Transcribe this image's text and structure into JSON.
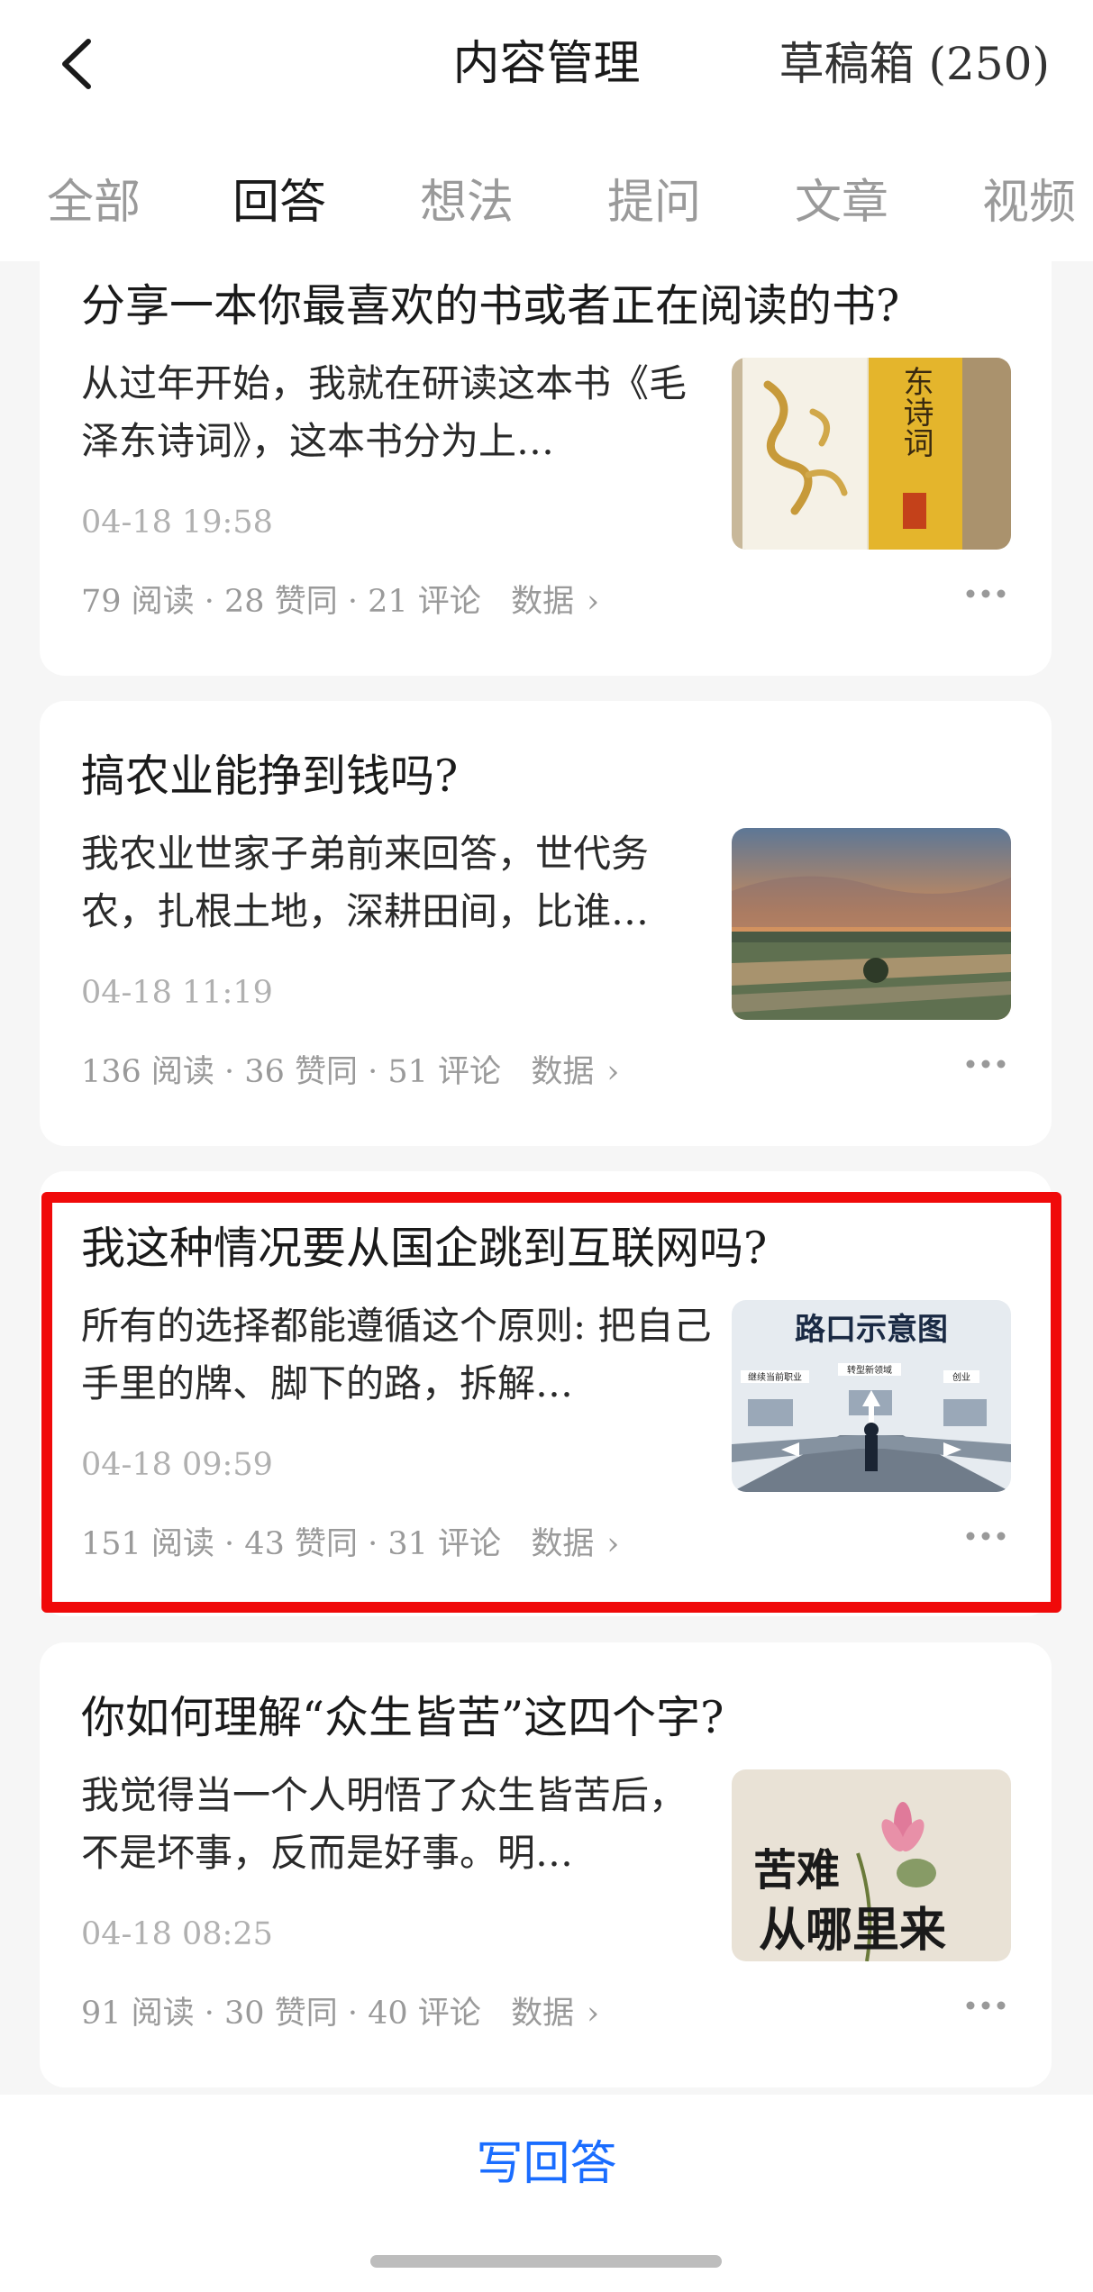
{
  "header": {
    "title": "内容管理",
    "drafts_label": "草稿箱 (250)"
  },
  "tabs": [
    {
      "label": "全部",
      "active": false
    },
    {
      "label": "回答",
      "active": true
    },
    {
      "label": "想法",
      "active": false
    },
    {
      "label": "提问",
      "active": false
    },
    {
      "label": "文章",
      "active": false
    },
    {
      "label": "视频",
      "active": false
    }
  ],
  "answers": [
    {
      "title": "分享一本你最喜欢的书或者正在阅读的书?",
      "excerpt": "从过年开始，我就在研读这本书《毛泽东诗词》，这本书分为上…",
      "time": "04-18 19:58",
      "stats": "79 阅读 · 28 赞同 · 21 评论",
      "data_link": "数据",
      "thumb_text": "东诗词"
    },
    {
      "title": "搞农业能挣到钱吗?",
      "excerpt": "我农业世家子弟前来回答，世代务农，扎根土地，深耕田间，比谁…",
      "time": "04-18 11:19",
      "stats": "136 阅读 · 36 赞同 · 51 评论",
      "data_link": "数据"
    },
    {
      "title": "我这种情况要从国企跳到互联网吗?",
      "excerpt": "所有的选择都能遵循这个原则: 把自己手里的牌、脚下的路，拆解…",
      "time": "04-18 09:59",
      "stats": "151 阅读 · 43 赞同 · 31 评论",
      "data_link": "数据",
      "thumb_text": "路口示意图",
      "thumb_labels": [
        "继续当前职业",
        "转型新领域",
        "创业"
      ]
    },
    {
      "title": "你如何理解“众生皆苦”这四个字?",
      "excerpt": "我觉得当一个人明悟了众生皆苦后，不是坏事，反而是好事。明…",
      "time": "04-18 08:25",
      "stats": "91 阅读 · 30 赞同 · 40 评论",
      "data_link": "数据",
      "thumb_text_1": "苦难",
      "thumb_text_2": "从哪里来"
    }
  ],
  "bottom": {
    "write_label": "写回答"
  },
  "colors": {
    "accent": "#1a6dff",
    "highlight": "#f00a0a"
  }
}
